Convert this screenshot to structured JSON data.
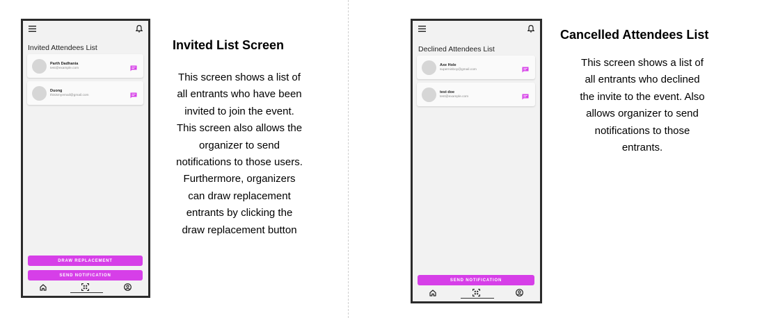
{
  "left_screen": {
    "title": "Invited Attendees List",
    "attendees": [
      {
        "name": "Parth Dadhania",
        "email": "test@example.com"
      },
      {
        "name": "Duong",
        "email": "thisismyemail@gmail.com"
      }
    ],
    "draw_replacement_label": "DRAW REPLACEMENT",
    "send_notification_label": "SEND NOTIFICATION"
  },
  "left_description": {
    "heading": "Invited List Screen",
    "lines": [
      "This screen shows a list of",
      "all entrants who have been",
      "invited to join the event.",
      "This screen also allows the",
      "organizer to send",
      "notifications to those users.",
      "Furthermore, organizers",
      "can draw replacement",
      "entrants by clicking the",
      "draw replacement button"
    ]
  },
  "right_screen": {
    "title": "Declined Attendees List",
    "attendees": [
      {
        "name": "Axe Hole",
        "email": "superninboy@gmail.com"
      },
      {
        "name": "test doe",
        "email": "test@example.com"
      }
    ],
    "send_notification_label": "SEND NOTIFICATION"
  },
  "right_description": {
    "heading": "Cancelled Attendees List",
    "lines": [
      "This screen shows a list of",
      "all entrants who declined",
      "the invite to the event. Also",
      "allows organizer to send",
      "notifications to those",
      "entrants."
    ]
  },
  "icons": {
    "menu": "hamburger-menu-icon",
    "notifications": "bell-icon",
    "message": "chat-bubble-icon",
    "home": "home-icon",
    "scan": "qr-scan-icon",
    "profile": "account-circle-icon"
  },
  "colors": {
    "accent": "#d63fe8",
    "phone_frame": "#2b2b2b",
    "screen_bg": "#f2f2f2",
    "avatar": "#d6d6d6"
  }
}
